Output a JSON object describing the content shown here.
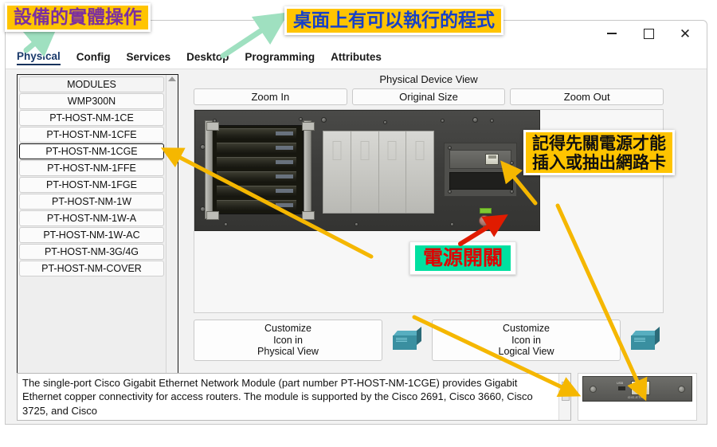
{
  "window": {
    "controls": {
      "minimize": "–",
      "maximize": "□",
      "close": "✕"
    }
  },
  "tabs": [
    {
      "label": "Physical",
      "active": true
    },
    {
      "label": "Config",
      "active": false
    },
    {
      "label": "Services",
      "active": false
    },
    {
      "label": "Desktop",
      "active": false
    },
    {
      "label": "Programming",
      "active": false
    },
    {
      "label": "Attributes",
      "active": false
    }
  ],
  "modules": {
    "header": "MODULES",
    "items": [
      "WMP300N",
      "PT-HOST-NM-1CE",
      "PT-HOST-NM-1CFE",
      "PT-HOST-NM-1CGE",
      "PT-HOST-NM-1FFE",
      "PT-HOST-NM-1FGE",
      "PT-HOST-NM-1W",
      "PT-HOST-NM-1W-A",
      "PT-HOST-NM-1W-AC",
      "PT-HOST-NM-3G/4G",
      "PT-HOST-NM-COVER"
    ],
    "selected": "PT-HOST-NM-1CGE"
  },
  "device_view": {
    "title": "Physical Device View",
    "zoom_in": "Zoom In",
    "original_size": "Original Size",
    "zoom_out": "Zoom Out"
  },
  "customize": {
    "physical": "Customize\nIcon in\nPhysical View",
    "physical_lines": [
      "Customize",
      "Icon in",
      "Physical View"
    ],
    "logical_lines": [
      "Customize",
      "Icon in",
      "Logical View"
    ]
  },
  "description": "The single-port Cisco Gigabit Ethernet Network Module (part number PT-HOST-NM-1CGE) provides Gigabit Ethernet copper connectivity for access routers. The module is supported by the Cisco 2691, Cisco 3660, Cisco 3725, and Cisco",
  "module_preview": {
    "port_label": "GIG-ETH 0",
    "usb_label": "USB"
  },
  "annotations": [
    {
      "id": "callout-physical",
      "text": "設備的實體操作",
      "fill": "#ffc400",
      "color": "#7b2fa0",
      "arrow": "green"
    },
    {
      "id": "callout-desktop",
      "text": "桌面上有可以執行的程式",
      "fill": "#ffc400",
      "color": "#1640c8",
      "arrow": "green"
    },
    {
      "id": "callout-power-warning",
      "line1": "記得先關電源才能",
      "line2": "插入或抽出網路卡",
      "fill": "#ffc400",
      "color": "#101010",
      "arrow": "yellow"
    },
    {
      "id": "callout-power-switch",
      "text": "電源開關",
      "fill": "#00e0a0",
      "color": "#e00000",
      "arrow": "red"
    }
  ],
  "colors": {
    "callout_yellow": "#ffc400",
    "callout_green": "#00e0a0",
    "arrow_yellow": "#f5b700",
    "arrow_green": "#9fe0c0",
    "arrow_red": "#e01b00",
    "purple_text": "#7b2fa0",
    "blue_text": "#1640c8",
    "red_text": "#e00000"
  }
}
